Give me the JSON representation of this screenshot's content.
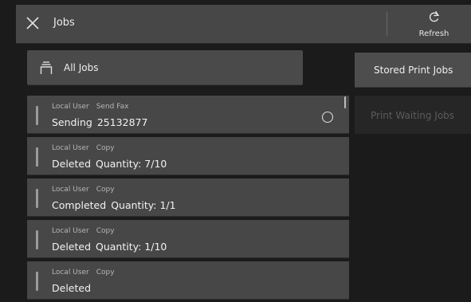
{
  "header": {
    "title": "Jobs",
    "close_icon": "close-icon",
    "refresh_label": "Refresh",
    "refresh_icon": "refresh-icon"
  },
  "filter": {
    "all_jobs_label": "All Jobs",
    "all_jobs_icon": "job-stack-icon"
  },
  "side_buttons": {
    "stored_print_jobs": "Stored Print Jobs",
    "print_waiting_jobs": "Print Waiting Jobs"
  },
  "jobs": [
    {
      "user": "Local User",
      "type": "Send Fax",
      "status": "Sending",
      "detail": "25132877",
      "busy": true
    },
    {
      "user": "Local User",
      "type": "Copy",
      "status": "Deleted",
      "detail": "Quantity: 7/10"
    },
    {
      "user": "Local User",
      "type": "Copy",
      "status": "Completed",
      "detail": "Quantity: 1/1"
    },
    {
      "user": "Local User",
      "type": "Copy",
      "status": "Deleted",
      "detail": "Quantity: 1/10"
    },
    {
      "user": "Local User",
      "type": "Copy",
      "status": "Deleted",
      "detail": ""
    }
  ]
}
